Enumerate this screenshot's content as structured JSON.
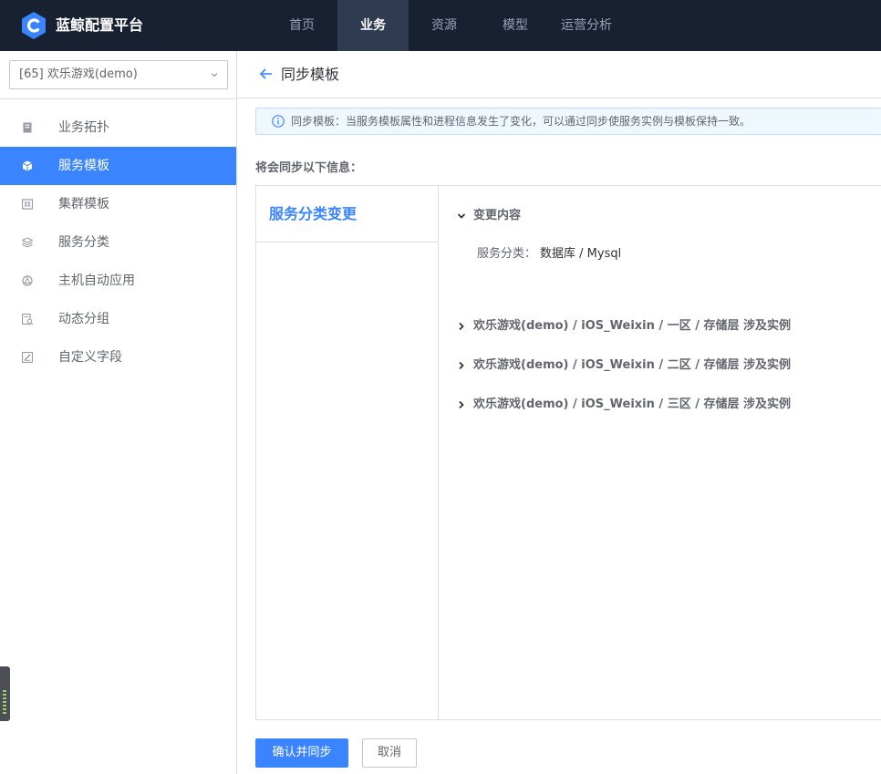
{
  "app": {
    "title": "蓝鲸配置平台"
  },
  "top_nav": [
    {
      "label": "首页",
      "active": false
    },
    {
      "label": "业务",
      "active": true
    },
    {
      "label": "资源",
      "active": false
    },
    {
      "label": "模型",
      "active": false
    },
    {
      "label": "运营分析",
      "active": false
    }
  ],
  "sidebar": {
    "business_select": {
      "value": "[65] 欢乐游戏(demo)"
    },
    "items": [
      {
        "label": "业务拓扑",
        "icon": "topology-icon",
        "active": false
      },
      {
        "label": "服务模板",
        "icon": "cube-icon",
        "active": true
      },
      {
        "label": "集群模板",
        "icon": "cluster-icon",
        "active": false
      },
      {
        "label": "服务分类",
        "icon": "layers-icon",
        "active": false
      },
      {
        "label": "主机自动应用",
        "icon": "auto-apply-icon",
        "active": false
      },
      {
        "label": "动态分组",
        "icon": "dynamic-group-icon",
        "active": false
      },
      {
        "label": "自定义字段",
        "icon": "custom-field-icon",
        "active": false
      }
    ]
  },
  "page": {
    "title": "同步模板",
    "alert": "同步模板：当服务模板属性和进程信息发生了变化，可以通过同步使服务实例与模板保持一致。",
    "section_label": "将会同步以下信息：",
    "tabs": [
      {
        "label": "服务分类变更",
        "active": true
      }
    ],
    "change_group": {
      "title": "变更内容",
      "expanded": true,
      "key": "服务分类：",
      "value": "数据库 / Mysql"
    },
    "instance_groups": [
      {
        "label": "欢乐游戏(demo) / iOS_Weixin / 一区 / 存储层 涉及实例",
        "expanded": false
      },
      {
        "label": "欢乐游戏(demo) / iOS_Weixin / 二区 / 存储层 涉及实例",
        "expanded": false
      },
      {
        "label": "欢乐游戏(demo) / iOS_Weixin / 三区 / 存储层 涉及实例",
        "expanded": false
      }
    ],
    "buttons": {
      "confirm": "确认并同步",
      "cancel": "取消"
    }
  },
  "colors": {
    "primary": "#3a84ff",
    "topbar": "#182132",
    "topnav_active": "#2f3b50"
  }
}
